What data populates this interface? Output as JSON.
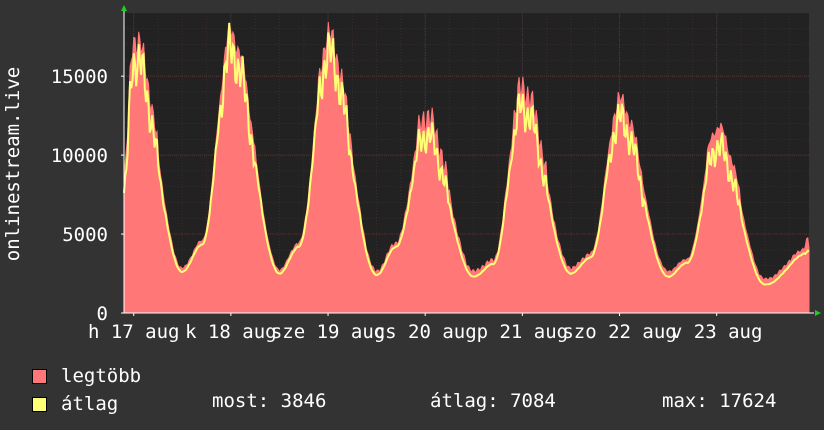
{
  "chart_data": {
    "type": "area",
    "ylabel": "onlinestream.live",
    "y_ticks": [
      0,
      5000,
      10000,
      15000
    ],
    "ylim": [
      0,
      19000
    ],
    "x_range_days": [
      16.9,
      23.95
    ],
    "x_ticks": [
      {
        "label": "h 17 aug",
        "day": 17
      },
      {
        "label": "k 18 aug",
        "day": 18
      },
      {
        "label": "sze 19 aug",
        "day": 19
      },
      {
        "label": "cs 20 aug",
        "day": 20
      },
      {
        "label": "p 21 aug",
        "day": 21
      },
      {
        "label": "szo 22 aug",
        "day": 22
      },
      {
        "label": "v 23 aug",
        "day": 23
      }
    ],
    "grid": true,
    "series": [
      {
        "name": "legtöbb",
        "color": "#ff7777",
        "style": "filled-area"
      },
      {
        "name": "átlag",
        "color": "#ffff77",
        "style": "line"
      }
    ],
    "daily_profile": [
      {
        "day": 16.9,
        "max": 8200,
        "avg": 7600
      },
      {
        "day": 17.0,
        "max": 17000,
        "avg": 16200
      },
      {
        "day": 17.5,
        "max": 2700,
        "avg": 2600
      },
      {
        "day": 17.7,
        "max": 4400,
        "avg": 4300
      },
      {
        "day": 18.0,
        "max": 17200,
        "avg": 16500
      },
      {
        "day": 18.5,
        "max": 2600,
        "avg": 2500
      },
      {
        "day": 18.7,
        "max": 4300,
        "avg": 4200
      },
      {
        "day": 19.0,
        "max": 17000,
        "avg": 16300
      },
      {
        "day": 19.5,
        "max": 2500,
        "avg": 2400
      },
      {
        "day": 19.7,
        "max": 4300,
        "avg": 4200
      },
      {
        "day": 20.0,
        "max": 12000,
        "avg": 11300
      },
      {
        "day": 20.5,
        "max": 2500,
        "avg": 2300
      },
      {
        "day": 20.7,
        "max": 3200,
        "avg": 3100
      },
      {
        "day": 21.0,
        "max": 13800,
        "avg": 13000
      },
      {
        "day": 21.5,
        "max": 2700,
        "avg": 2500
      },
      {
        "day": 21.7,
        "max": 3600,
        "avg": 3500
      },
      {
        "day": 22.0,
        "max": 12900,
        "avg": 12200
      },
      {
        "day": 22.5,
        "max": 2500,
        "avg": 2300
      },
      {
        "day": 22.7,
        "max": 3300,
        "avg": 3200
      },
      {
        "day": 23.0,
        "max": 11300,
        "avg": 10500
      },
      {
        "day": 23.5,
        "max": 2000,
        "avg": 1800
      },
      {
        "day": 23.95,
        "max": 4000,
        "avg": 3846
      }
    ]
  },
  "legend": {
    "max_label": "legtöbb",
    "avg_label": "átlag"
  },
  "stats": {
    "current": "most: 3846",
    "average": "átlag: 7084",
    "maximum": "max: 17624"
  },
  "colors": {
    "background": "#333333",
    "plot_bg": "#222222",
    "grid_major": "#553333",
    "grid_minor": "#3a2c2c",
    "max_fill": "#ff7777",
    "avg_line": "#ffff77",
    "axis_arrow": "#22cc22"
  }
}
